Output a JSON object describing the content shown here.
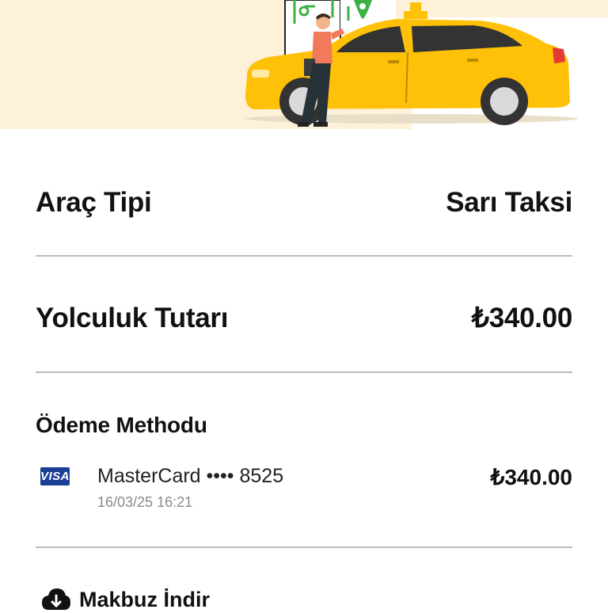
{
  "ride": {
    "vehicle_type_label": "Araç Tipi",
    "vehicle_type_value": "Sarı Taksi",
    "fare_label": "Yolculuk Tutarı",
    "fare_value": "₺340.00"
  },
  "payment": {
    "section_title": "Ödeme Methodu",
    "card_brand_badge": "VISA",
    "card_name": "MasterCard •••• 8525",
    "card_datetime": "16/03/25 16:21",
    "card_amount": "₺340.00"
  },
  "actions": {
    "download_receipt_label": "Makbuz İndir",
    "download_icon": "cloud-download-icon"
  },
  "colors": {
    "hero_bg": "#fdf1d9",
    "taxi_yellow": "#ffc107",
    "visa_blue": "#1a3f96",
    "divider": "#bdbdbd"
  }
}
